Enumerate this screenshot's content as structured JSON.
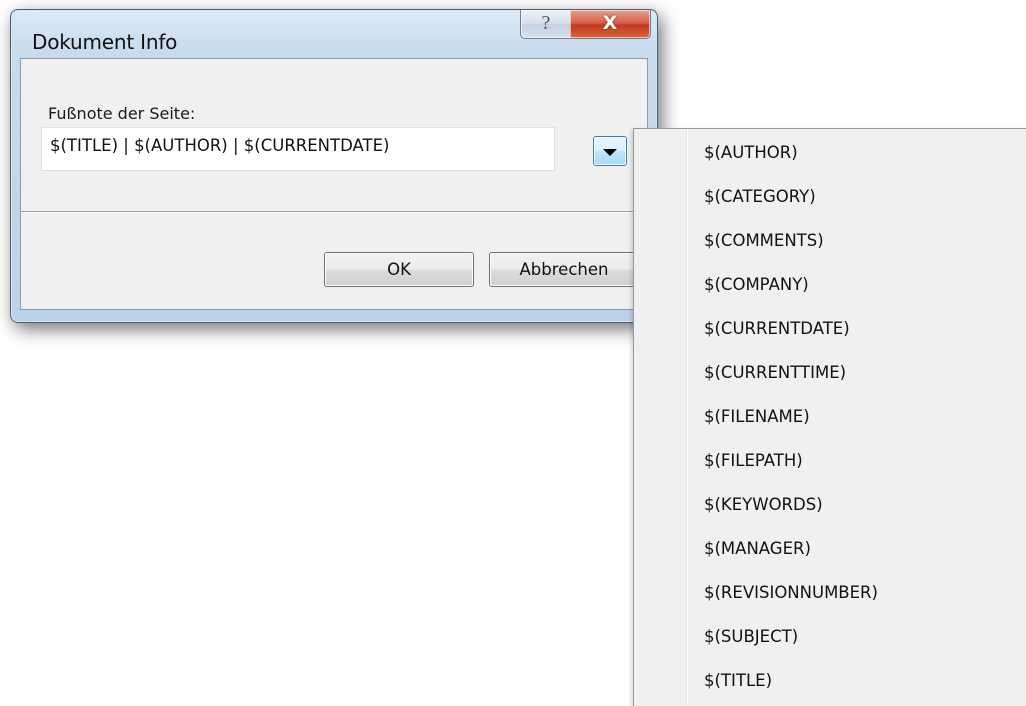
{
  "window": {
    "title": "Dokument Info",
    "help_glyph": "?",
    "close_glyph": "X"
  },
  "form": {
    "label": "Fußnote der Seite:",
    "value": "$(TITLE) | $(AUTHOR) | $(CURRENTDATE)"
  },
  "buttons": {
    "ok": "OK",
    "cancel": "Abbrechen"
  },
  "menu": {
    "items": [
      "$(AUTHOR)",
      "$(CATEGORY)",
      "$(COMMENTS)",
      "$(COMPANY)",
      "$(CURRENTDATE)",
      "$(CURRENTTIME)",
      "$(FILENAME)",
      "$(FILEPATH)",
      "$(KEYWORDS)",
      "$(MANAGER)",
      "$(REVISIONNUMBER)",
      "$(SUBJECT)",
      "$(TITLE)"
    ]
  },
  "icons": {
    "help": "help-icon",
    "close": "close-icon",
    "dropdown": "chevron-down-icon"
  }
}
